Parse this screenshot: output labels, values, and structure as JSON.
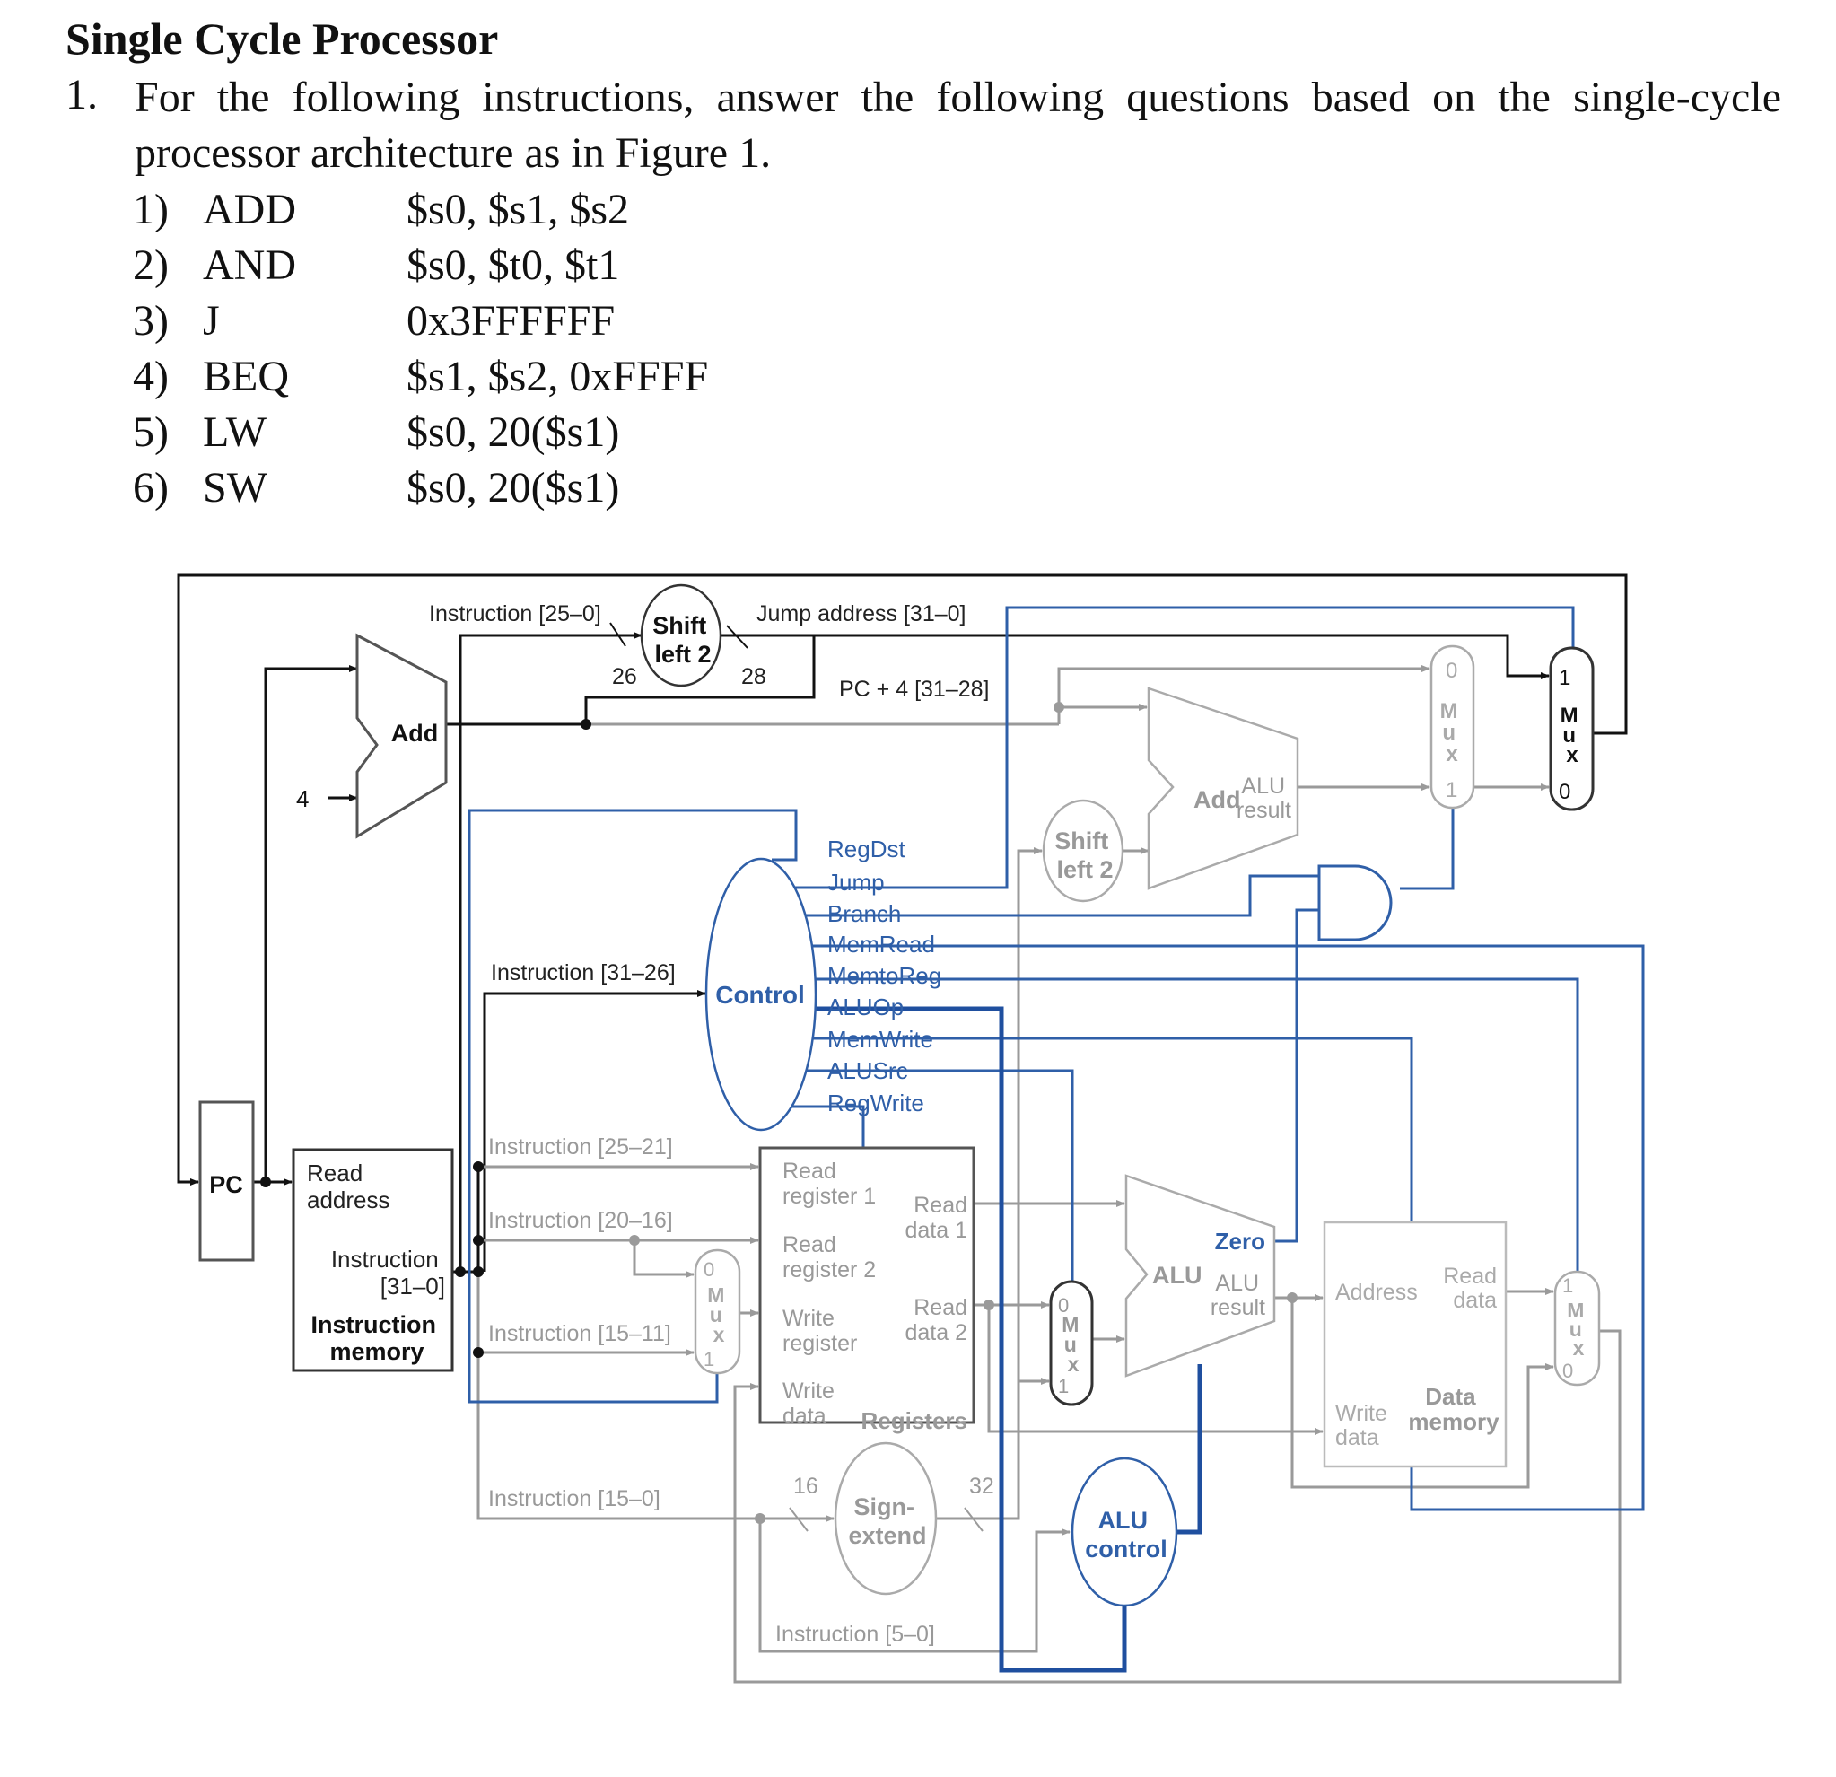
{
  "title": "Single Cycle Processor",
  "question": {
    "number": "1.",
    "text": "For the following instructions, answer the following questions based on the single-cycle processor architecture as in Figure 1."
  },
  "instructions": [
    {
      "num": "1)",
      "op": "ADD",
      "args": "$s0, $s1, $s2"
    },
    {
      "num": "2)",
      "op": "AND",
      "args": "$s0, $t0, $t1"
    },
    {
      "num": "3)",
      "op": "J",
      "args": "0x3FFFFFF"
    },
    {
      "num": "4)",
      "op": "BEQ",
      "args": "$s1, $s2, 0xFFFF"
    },
    {
      "num": "5)",
      "op": "LW",
      "args": "$s0, 20($s1)"
    },
    {
      "num": "6)",
      "op": "SW",
      "args": "$s0, 20($s1)"
    }
  ],
  "colors": {
    "control_blue": "#2f5fa8",
    "datapath_black": "#111111",
    "inactive_gray": "#9a9a9a"
  },
  "diagram": {
    "pc": "PC",
    "pc_adder": "Add",
    "four": "4",
    "instr_25_0": "Instruction [25–0]",
    "shift_top_1": "Shift",
    "shift_top_2": "left 2",
    "width_26": "26",
    "width_28": "28",
    "jump_address": "Jump address [31–0]",
    "pc4_31_28": "PC + 4 [31–28]",
    "branch_add": "Add",
    "branch_add_result_1": "ALU",
    "branch_add_result_2": "result",
    "shift_branch_1": "Shift",
    "shift_branch_2": "left 2",
    "mux_label": [
      "M",
      "u",
      "x"
    ],
    "mux_in_0": "0",
    "mux_in_1": "1",
    "control": "Control",
    "instr_31_26": "Instruction [31–26]",
    "control_signals": [
      "RegDst",
      "Jump",
      "Branch",
      "MemRead",
      "MemtoReg",
      "ALUOp",
      "MemWrite",
      "ALUSrc",
      "RegWrite"
    ],
    "imem_read_address_1": "Read",
    "imem_read_address_2": "address",
    "imem_instruction_1": "Instruction",
    "imem_instruction_2": "[31–0]",
    "imem_title_1": "Instruction",
    "imem_title_2": "memory",
    "instr_25_21": "Instruction [25–21]",
    "instr_20_16": "Instruction [20–16]",
    "instr_15_11": "Instruction [15–11]",
    "instr_15_0": "Instruction [15–0]",
    "instr_5_0": "Instruction [5–0]",
    "reg_read1_1": "Read",
    "reg_read1_2": "register 1",
    "reg_read2_1": "Read",
    "reg_read2_2": "register 2",
    "reg_write_1": "Write",
    "reg_write_2": "register",
    "reg_wdata_1": "Write",
    "reg_wdata_2": "data",
    "reg_rd1_1": "Read",
    "reg_rd1_2": "data 1",
    "reg_rd2_1": "Read",
    "reg_rd2_2": "data 2",
    "registers": "Registers",
    "sign_1": "Sign-",
    "sign_2": "extend",
    "width_16": "16",
    "width_32": "32",
    "alu": "ALU",
    "alu_zero": "Zero",
    "alu_result_1": "ALU",
    "alu_result_2": "result",
    "alu_control_1": "ALU",
    "alu_control_2": "control",
    "dmem_address": "Address",
    "dmem_read_1": "Read",
    "dmem_read_2": "data",
    "dmem_write_1": "Write",
    "dmem_write_2": "data",
    "dmem_title_1": "Data",
    "dmem_title_2": "memory"
  }
}
